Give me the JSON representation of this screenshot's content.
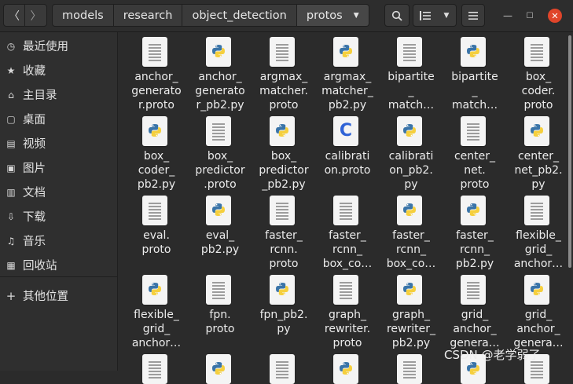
{
  "header": {
    "back_icon": "chevron-left-icon",
    "forward_icon": "chevron-right-icon",
    "breadcrumbs": [
      "models",
      "research",
      "object_detection",
      "protos"
    ],
    "search_icon": "search-icon",
    "view_icon": "list-view-icon",
    "menu_icon": "hamburger-menu-icon",
    "close_color": "#e0452a"
  },
  "sidebar": {
    "items": [
      {
        "label": "最近使用",
        "icon": "clock-icon"
      },
      {
        "label": "收藏",
        "icon": "star-icon"
      },
      {
        "label": "主目录",
        "icon": "home-icon"
      },
      {
        "label": "桌面",
        "icon": "desktop-icon"
      },
      {
        "label": "视频",
        "icon": "video-icon"
      },
      {
        "label": "图片",
        "icon": "pictures-icon"
      },
      {
        "label": "文档",
        "icon": "documents-icon"
      },
      {
        "label": "下载",
        "icon": "download-icon"
      },
      {
        "label": "音乐",
        "icon": "music-icon"
      },
      {
        "label": "回收站",
        "icon": "trash-icon"
      },
      {
        "label": "其他位置",
        "icon": "plus-icon"
      }
    ]
  },
  "files": [
    {
      "name": "anchor_\ngenerato\nr.proto",
      "type": "doc"
    },
    {
      "name": "anchor_\ngenerato\nr_pb2.py",
      "type": "py"
    },
    {
      "name": "argmax_\nmatcher.\nproto",
      "type": "doc"
    },
    {
      "name": "argmax_\nmatcher_\npb2.py",
      "type": "py"
    },
    {
      "name": "bipartite\n_\nmatch…",
      "type": "doc"
    },
    {
      "name": "bipartite\n_\nmatch…",
      "type": "py"
    },
    {
      "name": "box_\ncoder.\nproto",
      "type": "doc"
    },
    {
      "name": "box_\ncoder_\npb2.py",
      "type": "py"
    },
    {
      "name": "box_\npredictor\n.proto",
      "type": "doc"
    },
    {
      "name": "box_\npredictor\n_pb2.py",
      "type": "py"
    },
    {
      "name": "calibrati\non.proto",
      "type": "c"
    },
    {
      "name": "calibrati\non_pb2.\npy",
      "type": "py"
    },
    {
      "name": "center_\nnet.\nproto",
      "type": "doc"
    },
    {
      "name": "center_\nnet_pb2.\npy",
      "type": "py"
    },
    {
      "name": "eval.\nproto",
      "type": "doc"
    },
    {
      "name": "eval_\npb2.py",
      "type": "py"
    },
    {
      "name": "faster_\nrcnn.\nproto",
      "type": "doc"
    },
    {
      "name": "faster_\nrcnn_\nbox_co…",
      "type": "doc"
    },
    {
      "name": "faster_\nrcnn_\nbox_co…",
      "type": "py"
    },
    {
      "name": "faster_\nrcnn_\npb2.py",
      "type": "py"
    },
    {
      "name": "flexible_\ngrid_\nanchor…",
      "type": "doc"
    },
    {
      "name": "flexible_\ngrid_\nanchor…",
      "type": "py"
    },
    {
      "name": "fpn.\nproto",
      "type": "doc"
    },
    {
      "name": "fpn_pb2.\npy",
      "type": "py"
    },
    {
      "name": "graph_\nrewriter.\nproto",
      "type": "doc"
    },
    {
      "name": "graph_\nrewriter_\npb2.py",
      "type": "py"
    },
    {
      "name": "grid_\nanchor_\ngenera…",
      "type": "doc"
    },
    {
      "name": "grid_\nanchor_\ngenera…",
      "type": "py"
    },
    {
      "name": "",
      "type": "doc"
    },
    {
      "name": "",
      "type": "py"
    },
    {
      "name": "",
      "type": "doc"
    },
    {
      "name": "",
      "type": "py"
    },
    {
      "name": "",
      "type": "doc"
    },
    {
      "name": "",
      "type": "py"
    },
    {
      "name": "",
      "type": "doc"
    }
  ],
  "watermark": "CSDN @老学弱了"
}
